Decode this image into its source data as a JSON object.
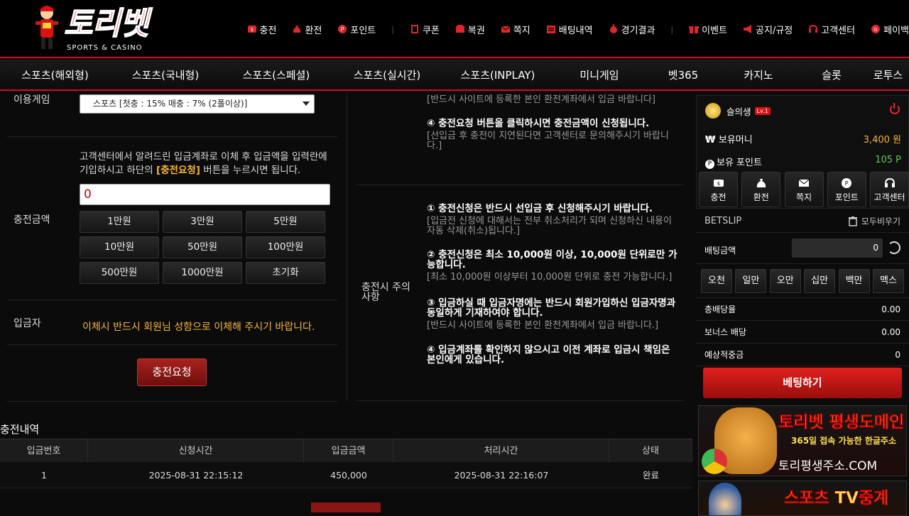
{
  "header": {
    "logo_text": "토리벳",
    "logo_sub": "SPORTS & CASINO",
    "menu": [
      {
        "label": "충전",
        "icon": "charge-icon"
      },
      {
        "label": "환전",
        "icon": "moneybag-icon"
      },
      {
        "label": "포인트",
        "icon": "point-icon"
      },
      {
        "label": "쿠폰",
        "icon": "coupon-icon"
      },
      {
        "label": "복권",
        "icon": "lottery-icon"
      },
      {
        "label": "쪽지",
        "icon": "mail-icon"
      },
      {
        "label": "배팅내역",
        "icon": "betting-history-icon"
      },
      {
        "label": "경기결과",
        "icon": "result-icon"
      },
      {
        "label": "이벤트",
        "icon": "gift-icon"
      },
      {
        "label": "공지/규정",
        "icon": "megaphone-icon"
      },
      {
        "label": "고객센터",
        "icon": "headset-icon"
      },
      {
        "label": "페이백",
        "icon": "payback-icon"
      }
    ],
    "accent": "#c8102e"
  },
  "nav": [
    "스포츠(해외형)",
    "스포츠(국내형)",
    "스포츠(스페셜)",
    "스포츠(실시간)",
    "스포츠(INPLAY)",
    "미니게임",
    "벳365",
    "카지노",
    "슬롯",
    "로투스"
  ],
  "form": {
    "game_label": "이용게임",
    "game_select": "스포츠 [첫충 : 15% 매충 : 7% (2폴이상)]",
    "guide_pre": "고객센터에서 알려드린 입금계좌로 이체 후 입금액을 입력란에 기입하시고 하단의 ",
    "guide_hl": "[충전요청]",
    "guide_post": " 버튼을 누르시면 됩니다.",
    "amount_label": "충전금액",
    "amount_value": "0",
    "amount_buttons": [
      "1만원",
      "3만원",
      "5만원",
      "10만원",
      "50만원",
      "100만원",
      "500만원",
      "1000만원",
      "초기화"
    ],
    "depositor_label": "입금자",
    "depositor_note": "이체시 반드시 회원님 성함으로 이체해 주시기 바랍니다.",
    "submit": "충전요청"
  },
  "notice": {
    "label": "충전시 주의사항",
    "top": [
      {
        "gray": "[반드시 사이트에 등록한 본인 환전계좌에서 입금 바랍니다]"
      },
      {
        "bold": "④ 충전요청 버튼을 클릭하시면 충전금액이 신청됩니다.",
        "gray": "[선입금 후 충전이 지연된다면 고객센터로 문의해주시기 바랍니다.]"
      }
    ],
    "items": [
      {
        "bold": "① 충전신청은 반드시 선입금 후 신청해주시기 바랍니다.",
        "gray": "[입금전 신청에 대해서는 전부 취소처리가 되며 신청하신 내용이 자동 삭제(취소)됩니다.]"
      },
      {
        "bold": "② 충전신청은 최소 10,000원 이상, 10,000원 단위로만 가능합니다.",
        "gray": "[최소 10,000원 이상부터 10,000원 단위로 충전 가능합니다.]"
      },
      {
        "bold": "③ 입금하실 때 입금자명에는 반드시 회원가입하신 입금자명과 동일하게 기재하여야 합니다.",
        "gray": "[반드시 사이트에 등록한 본인 환전계좌에서 입금 바랍니다.]"
      },
      {
        "bold": "④ 입금계좌를 확인하지 않으시고 이전 계좌로 입금시 책임은 본인에게 있습니다.",
        "gray": ""
      }
    ]
  },
  "history": {
    "title": "충전내역",
    "columns": [
      "입금번호",
      "신청시간",
      "입금금액",
      "처리시간",
      "상태"
    ],
    "rows": [
      [
        "1",
        "2025-08-31 22:15:12",
        "450,000",
        "2025-08-31 22:16:07",
        "완료"
      ]
    ]
  },
  "side": {
    "username": "슬의생",
    "level": "Lv.1",
    "money_label": "보유머니",
    "money_value": "3,400 원",
    "point_label": "보유 포인트",
    "point_value": "105 P",
    "quick": [
      {
        "label": "충전",
        "icon": "charge-icon"
      },
      {
        "label": "환전",
        "icon": "moneybag-icon"
      },
      {
        "label": "쪽지",
        "icon": "mail-icon"
      },
      {
        "label": "포인트",
        "icon": "point-icon"
      },
      {
        "label": "고객센터",
        "icon": "headset-icon"
      }
    ],
    "betslip_title": "BETSLIP",
    "clear_all": "모두비우기",
    "bet_amount_label": "배팅금액",
    "bet_amount_value": "0",
    "chips": [
      "오천",
      "일만",
      "오만",
      "십만",
      "백만",
      "맥스"
    ],
    "stats": [
      {
        "k": "총배당율",
        "v": "0.00"
      },
      {
        "k": "보너스 배당",
        "v": "0.00"
      },
      {
        "k": "예상적중금",
        "v": "0"
      }
    ],
    "bet_button": "베팅하기",
    "banner1_title": "토리벳 평생도메인",
    "banner1_sub": "365일 접속 가능한 한글주소",
    "banner1_url": "토리평생주소.COM",
    "banner2_title": "스포츠 TV중계"
  }
}
